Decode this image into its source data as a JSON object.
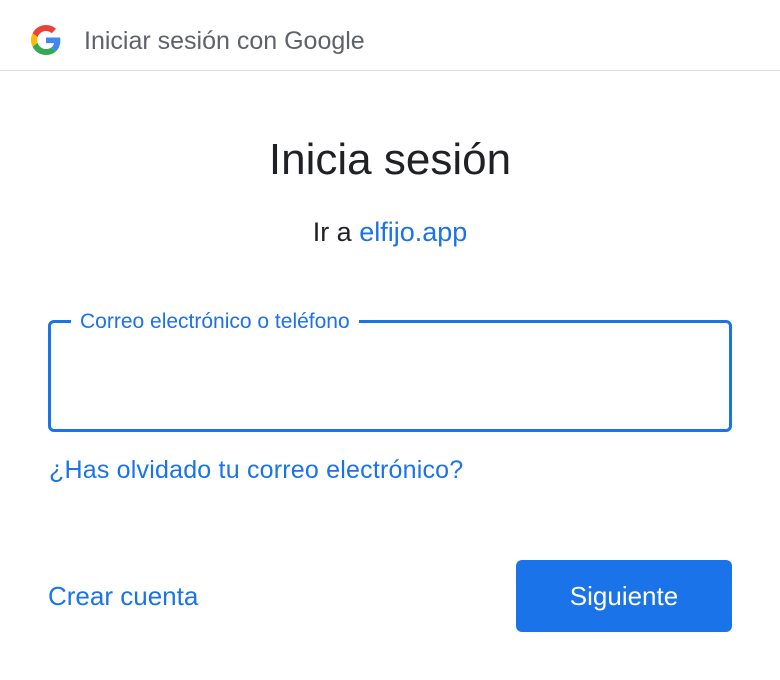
{
  "header": {
    "title": "Iniciar sesión con Google",
    "logo_icon": "google-g-icon",
    "logo_colors": [
      "#4285F4",
      "#EA4335",
      "#FBBC05",
      "#34A853"
    ]
  },
  "main": {
    "title": "Inicia sesión",
    "subtitle_prefix": "Ir a",
    "app_name": "elfijo.app"
  },
  "email_field": {
    "label": "Correo electrónico o teléfono",
    "value": ""
  },
  "links": {
    "forgot_email": "¿Has olvidado tu correo electrónico?",
    "create_account": "Crear cuenta"
  },
  "buttons": {
    "next": "Siguiente"
  },
  "colors": {
    "accent": "#1a73e8",
    "text": "#202124",
    "muted": "#5f6368",
    "divider": "#dadce0"
  }
}
